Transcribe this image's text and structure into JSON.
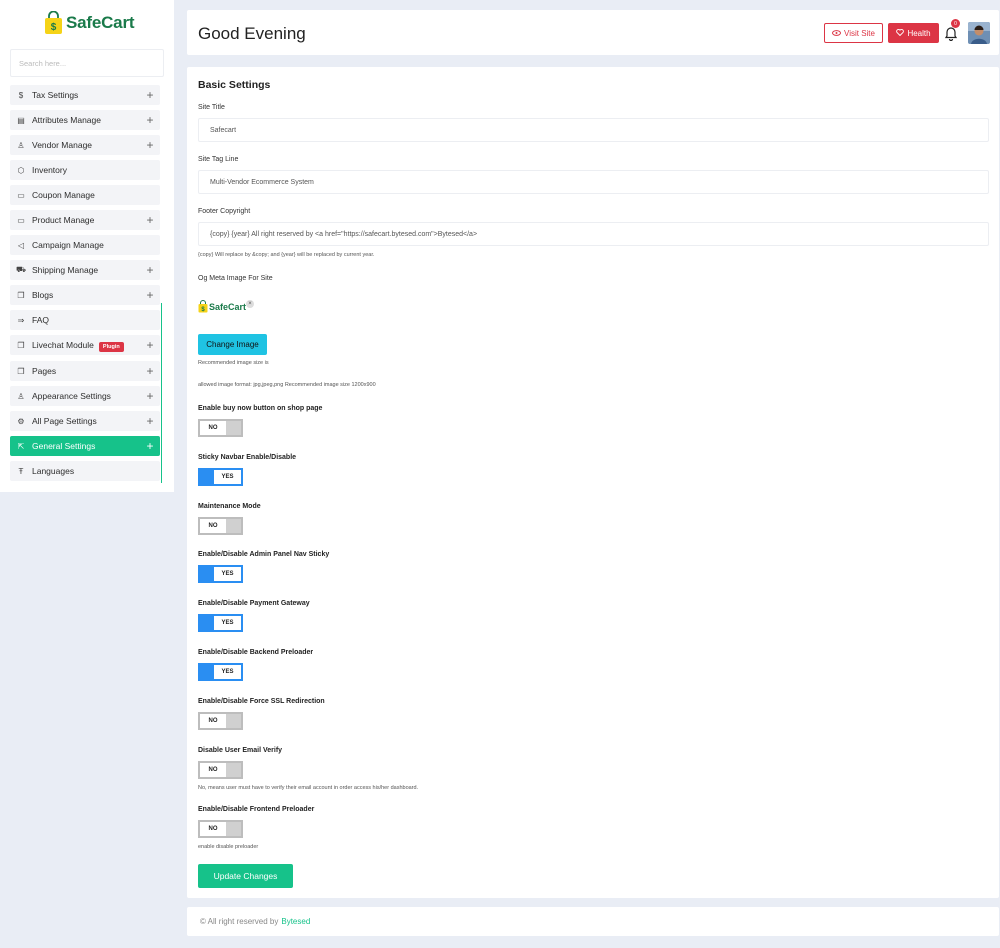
{
  "brand": {
    "name": "SafeCart"
  },
  "search": {
    "placeholder": "Search here..."
  },
  "sidebar": {
    "items": [
      {
        "label": "Tax Settings",
        "icon": "dollar-icon",
        "glyph": "$",
        "expandable": true
      },
      {
        "label": "Attributes Manage",
        "icon": "list-icon",
        "glyph": "▤",
        "expandable": true
      },
      {
        "label": "Vendor Manage",
        "icon": "user-icon",
        "glyph": "♙",
        "expandable": true
      },
      {
        "label": "Inventory",
        "icon": "box-icon",
        "glyph": "⬡",
        "expandable": false
      },
      {
        "label": "Coupon Manage",
        "icon": "folder-icon",
        "glyph": "▭",
        "expandable": false
      },
      {
        "label": "Product Manage",
        "icon": "folder-icon",
        "glyph": "▭",
        "expandable": true
      },
      {
        "label": "Campaign Manage",
        "icon": "megaphone-icon",
        "glyph": "◁",
        "expandable": false
      },
      {
        "label": "Shipping Manage",
        "icon": "truck-icon",
        "glyph": "⛟",
        "expandable": true
      },
      {
        "label": "Blogs",
        "icon": "copy-icon",
        "glyph": "❐",
        "expandable": true
      },
      {
        "label": "FAQ",
        "icon": "arrow-icon",
        "glyph": "⇒",
        "expandable": false
      },
      {
        "label": "Livechat Module",
        "icon": "copy-icon",
        "glyph": "❐",
        "expandable": true,
        "badge": "Plugin"
      },
      {
        "label": "Pages",
        "icon": "copy-icon",
        "glyph": "❐",
        "expandable": true
      },
      {
        "label": "Appearance Settings",
        "icon": "brush-icon",
        "glyph": "♙",
        "expandable": true
      },
      {
        "label": "All Page Settings",
        "icon": "gear-icon",
        "glyph": "⚙",
        "expandable": true
      },
      {
        "label": "General Settings",
        "icon": "external-icon",
        "glyph": "⇱",
        "expandable": true,
        "active": true
      },
      {
        "label": "Languages",
        "icon": "language-icon",
        "glyph": "Ŧ",
        "expandable": false
      }
    ]
  },
  "header": {
    "greeting": "Good Evening",
    "visit_label": "Visit Site",
    "health_label": "Health",
    "notification_count": "0"
  },
  "form": {
    "title": "Basic Settings",
    "site_title_label": "Site Title",
    "site_title_value": "Safecart",
    "tag_line_label": "Site Tag Line",
    "tag_line_value": "Multi-Vendor Ecommerce System",
    "footer_copyright_label": "Footer Copyright",
    "footer_copyright_value": "{copy}  {year}  All right reserved by  <a href=\"https://safecart.bytesed.com\">Bytesed</a>",
    "footer_copyright_hint": "{copy} Will replace by &copy; and {year} will be replaced by current year.",
    "og_label": "Og Meta Image For Site",
    "og_image_text": "SafeCart",
    "change_image_label": "Change Image",
    "recommended_hint": "Recommended image size is",
    "allowed_hint": "allowed image format: jpg,jpeg,png  Recommended image size 1200x900",
    "toggles": [
      {
        "label": "Enable buy now button on shop page",
        "state": "NO"
      },
      {
        "label": "Sticky Navbar Enable/Disable",
        "state": "YES"
      },
      {
        "label": "Maintenance Mode",
        "state": "NO"
      },
      {
        "label": "Enable/Disable Admin Panel Nav Sticky",
        "state": "YES"
      },
      {
        "label": "Enable/Disable Payment Gateway",
        "state": "YES"
      },
      {
        "label": "Enable/Disable Backend Preloader",
        "state": "YES"
      },
      {
        "label": "Enable/Disable Force SSL Redirection",
        "state": "NO"
      },
      {
        "label": "Disable User Email Verify",
        "state": "NO",
        "hint": "No, means user must have to verify their email account in order access his/her dashboard."
      },
      {
        "label": "Enable/Disable Frontend Preloader",
        "state": "NO",
        "hint": "enable disable preloader"
      }
    ],
    "update_label": "Update Changes"
  },
  "footer": {
    "text": "© All right reserved by",
    "link": "Bytesed"
  },
  "colors": {
    "accent": "#16c28a",
    "danger": "#dc3545",
    "toggle_on": "#2a8ef2",
    "info": "#1fc3e3",
    "brand": "#1a7a4a"
  }
}
